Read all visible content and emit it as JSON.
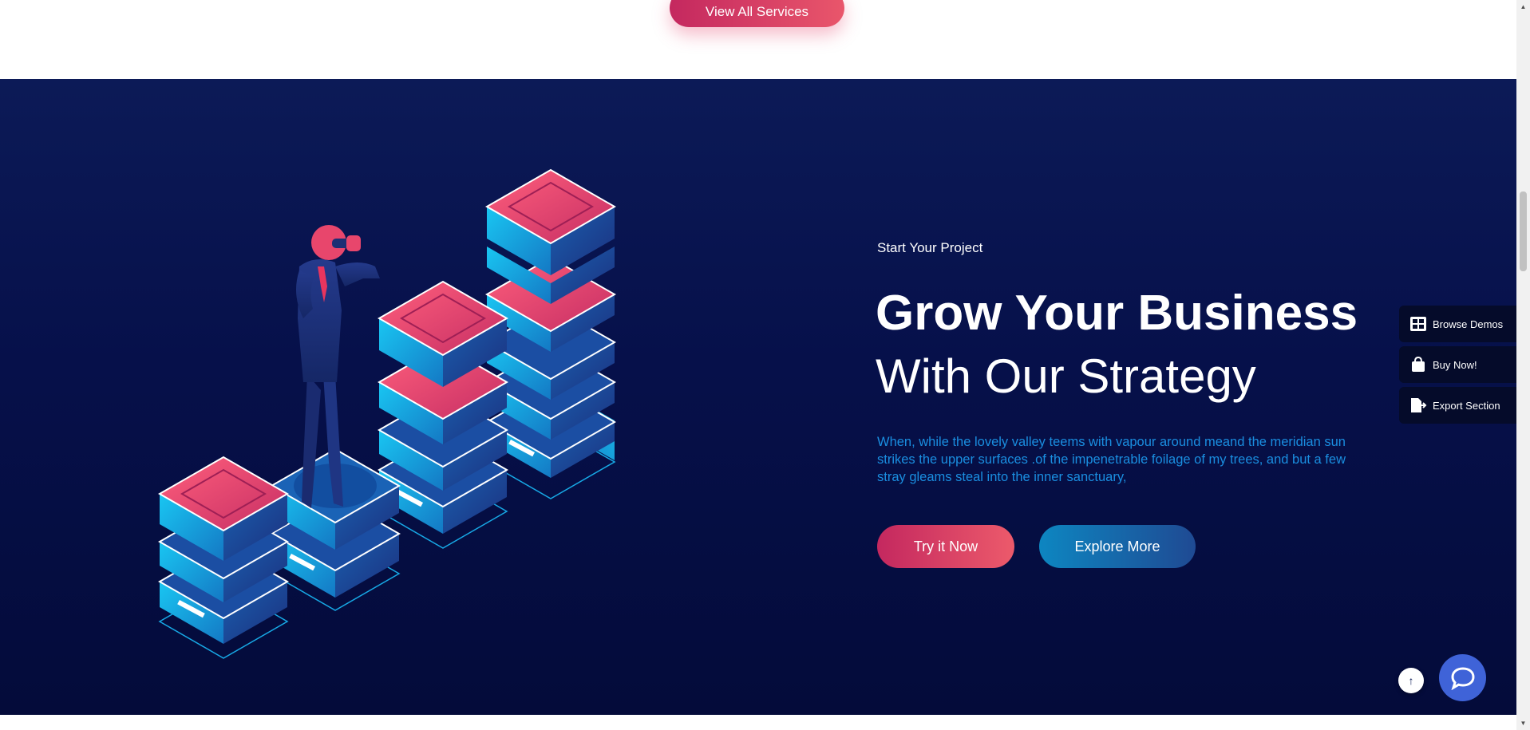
{
  "services": {
    "view_all_label": "View All Services"
  },
  "hero": {
    "eyebrow": "Start Your Project",
    "headline_bold": "Grow Your Business",
    "headline_regular": "With Our Strategy",
    "description": "When, while the lovely valley teems with vapour around meand the meridian sun strikes the upper surfaces .of the impenetrable foilage of my trees, and but a few stray gleams steal into the inner sanctuary,",
    "primary_cta": "Try it Now",
    "secondary_cta": "Explore More"
  },
  "side_panel": {
    "items": [
      {
        "label": "Browse Demos",
        "icon": "grid-icon"
      },
      {
        "label": "Buy Now!",
        "icon": "shopping-bag-icon"
      },
      {
        "label": "Export Section",
        "icon": "file-export-icon"
      }
    ]
  },
  "colors": {
    "accent_pink": "#d93a66",
    "accent_blue": "#0d86c1",
    "hero_background": "#06104a",
    "description_text": "#1a8ee0",
    "chat_button": "#3f63d8"
  }
}
